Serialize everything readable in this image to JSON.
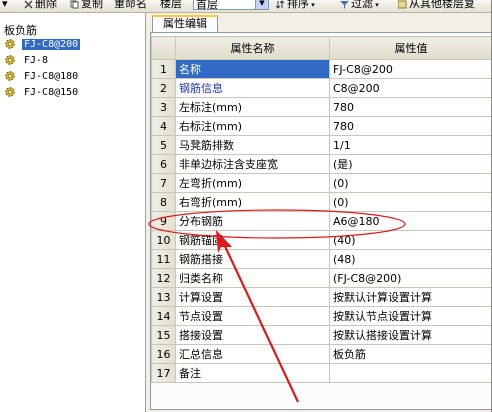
{
  "toolbar": {
    "items": [
      {
        "label": "▾",
        "icon": "dropdown-icon"
      },
      {
        "label": "删除",
        "icon": "delete-icon"
      },
      {
        "label": "复制",
        "icon": "copy-icon"
      },
      {
        "label": "重命名"
      },
      {
        "label": "楼层"
      },
      {
        "label": "排序",
        "icon": "sort-icon"
      },
      {
        "label": "过滤",
        "icon": "filter-icon"
      },
      {
        "label": "从其他楼层复",
        "icon": "copy-from-floor-icon"
      }
    ],
    "floor_combo_value": "首层"
  },
  "tree": {
    "root_label": "板负筋",
    "items": [
      {
        "label": "FJ-C8@200",
        "selected": true
      },
      {
        "label": "FJ-8",
        "selected": false
      },
      {
        "label": "FJ-C8@180",
        "selected": false
      },
      {
        "label": "FJ-C8@150",
        "selected": false
      }
    ]
  },
  "tab": {
    "label": "属性编辑"
  },
  "grid": {
    "headers": {
      "num": "",
      "name": "属性名称",
      "value": "属性值"
    },
    "rows": [
      {
        "num": "1",
        "name": "名称",
        "value": "FJ-C8@200"
      },
      {
        "num": "2",
        "name": "钢筋信息",
        "value": "C8@200"
      },
      {
        "num": "3",
        "name": "左标注(mm)",
        "value": "780"
      },
      {
        "num": "4",
        "name": "右标注(mm)",
        "value": "780"
      },
      {
        "num": "5",
        "name": "马凳筋排数",
        "value": "1/1"
      },
      {
        "num": "6",
        "name": "非单边标注含支座宽",
        "value": "(是)"
      },
      {
        "num": "7",
        "name": "左弯折(mm)",
        "value": "(0)"
      },
      {
        "num": "8",
        "name": "右弯折(mm)",
        "value": "(0)"
      },
      {
        "num": "9",
        "name": "分布钢筋",
        "value": "A6@180"
      },
      {
        "num": "10",
        "name": "钢筋锚固",
        "value": "(40)"
      },
      {
        "num": "11",
        "name": "钢筋搭接",
        "value": "(48)"
      },
      {
        "num": "12",
        "name": "归类名称",
        "value": "(FJ-C8@200)"
      },
      {
        "num": "13",
        "name": "计算设置",
        "value": "按默认计算设置计算"
      },
      {
        "num": "14",
        "name": "节点设置",
        "value": "按默认节点设置计算"
      },
      {
        "num": "15",
        "name": "搭接设置",
        "value": "按默认搭接设置计算"
      },
      {
        "num": "16",
        "name": "汇总信息",
        "value": "板负筋"
      },
      {
        "num": "17",
        "name": "备注",
        "value": ""
      }
    ]
  },
  "colors": {
    "selection": "#316ac5",
    "annotation": "#e01818",
    "blue_text": "#1a32b4"
  }
}
